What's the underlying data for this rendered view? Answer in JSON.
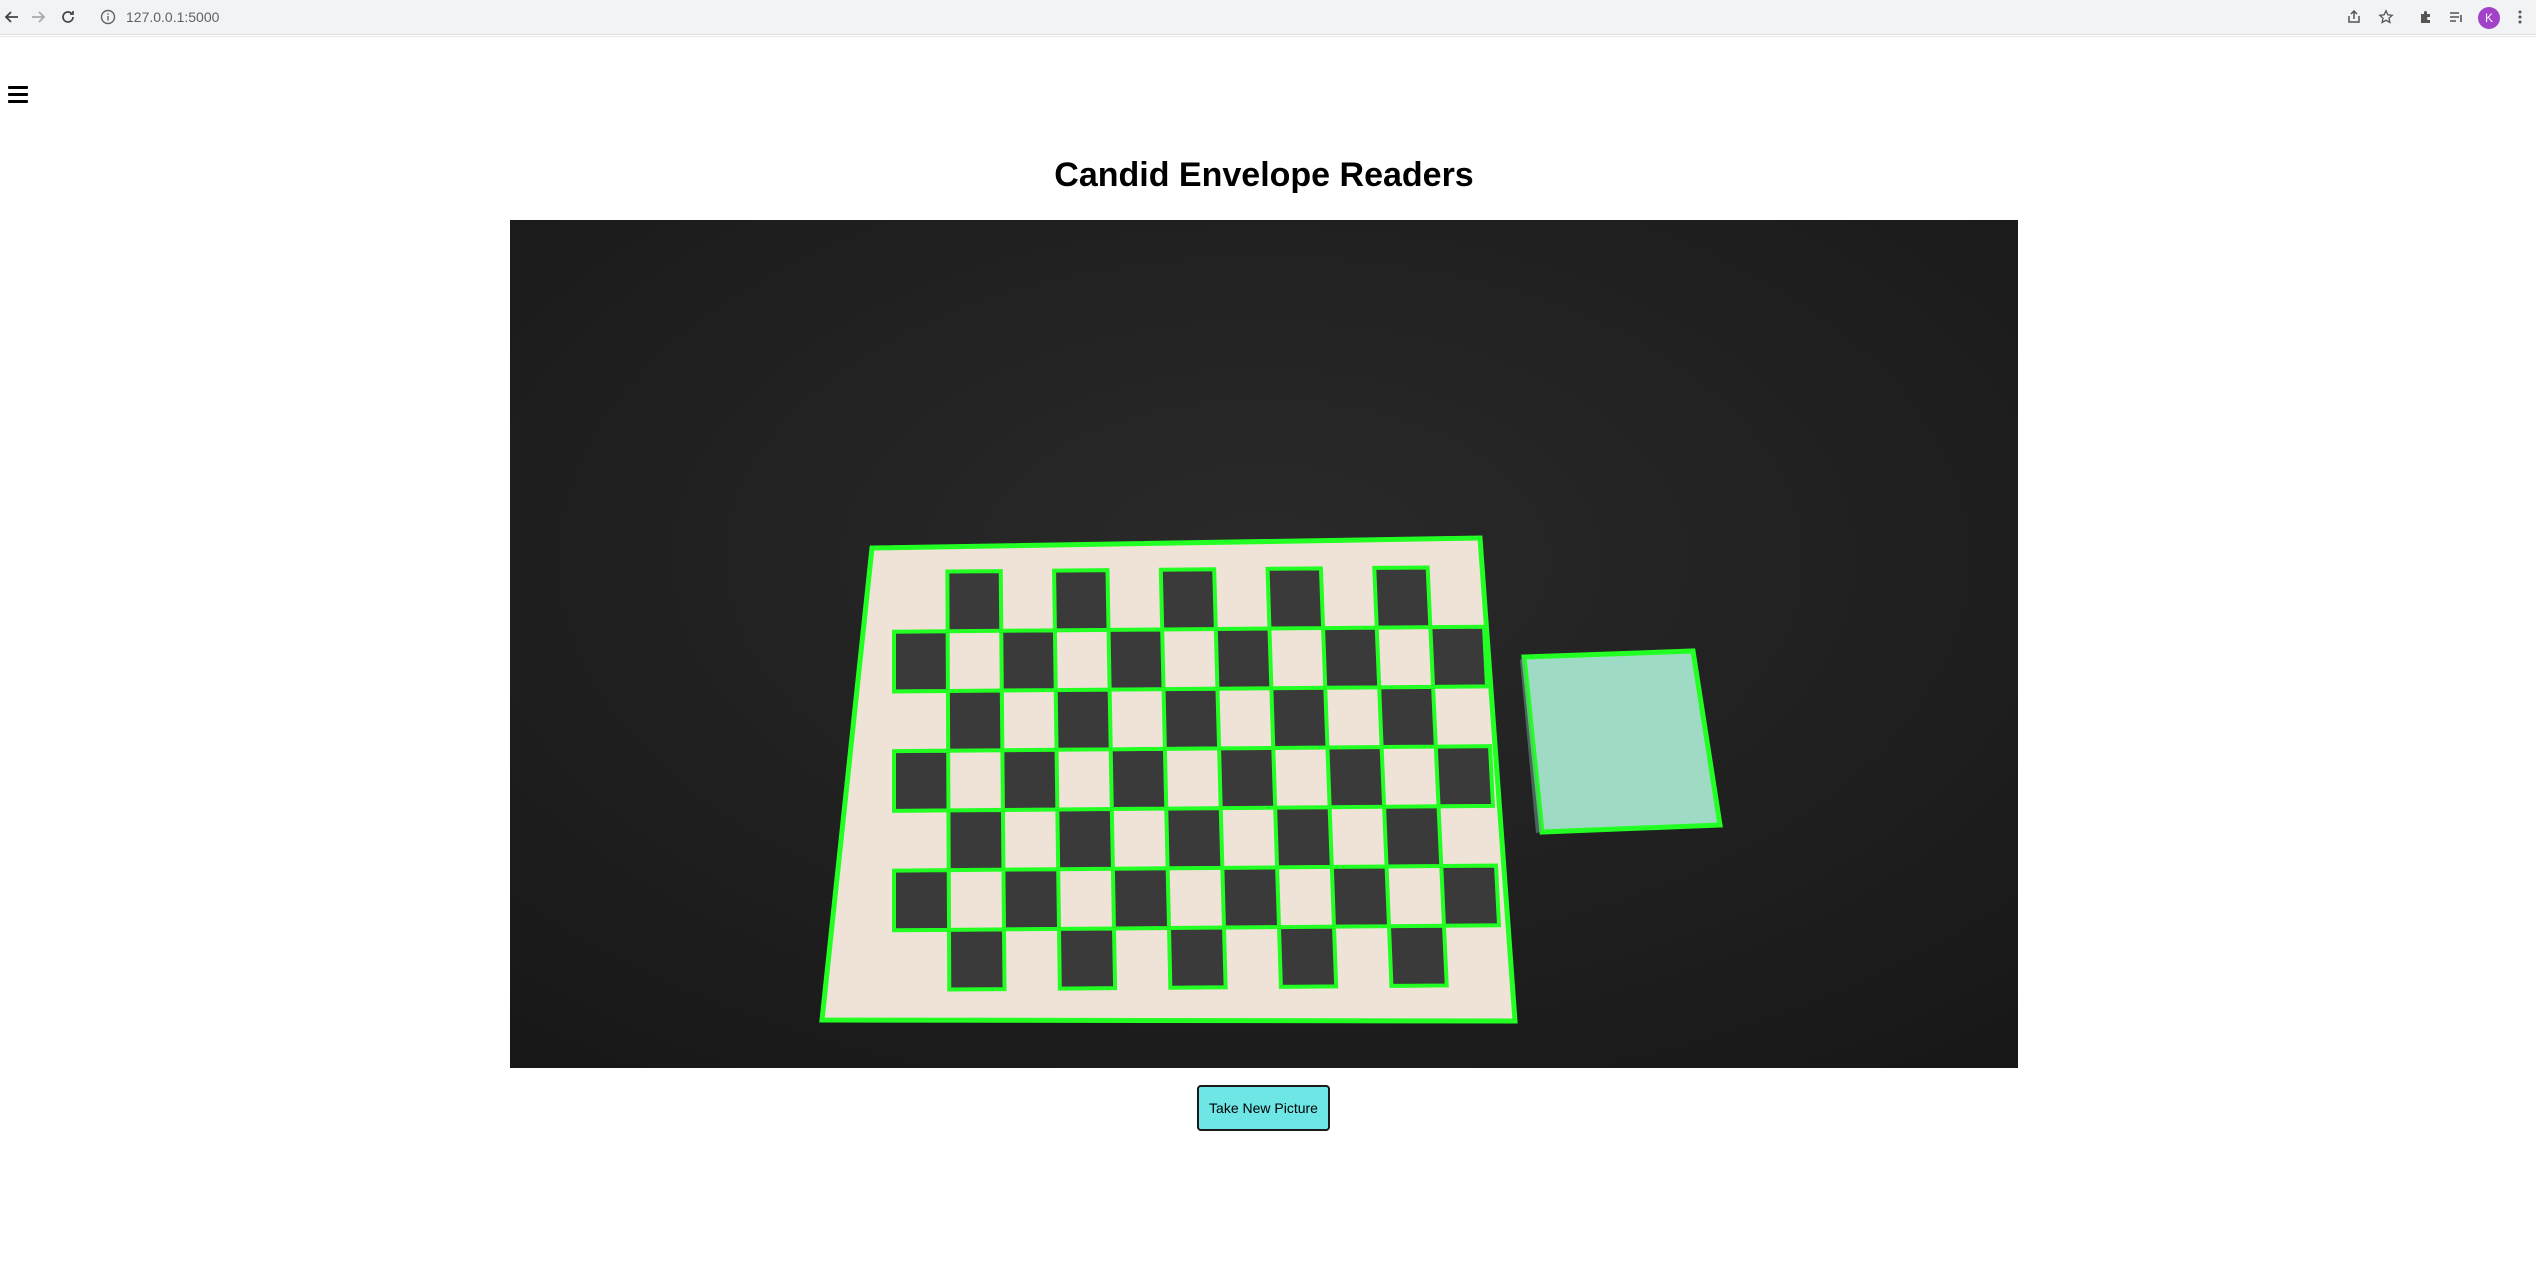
{
  "browser": {
    "url": "127.0.0.1:5000",
    "profile_initial": "K",
    "profile_color": "#a142c9"
  },
  "page": {
    "title": "Candid Envelope Readers",
    "menu_icon": "hamburger-menu-icon",
    "take_picture_label": "Take New Picture",
    "button_color": "#6fe6e6",
    "outline_color": "#00ff00"
  }
}
